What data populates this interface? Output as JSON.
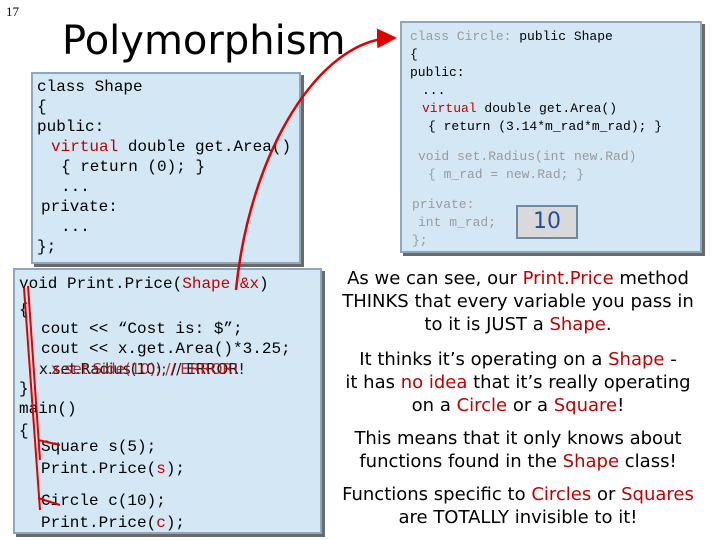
{
  "slide_number": "17",
  "title": "Polymorphism",
  "shape_class": {
    "l1": "class Shape",
    "l2": "{",
    "l3": "public:",
    "l4_kw": "virtual",
    "l4_rest": " double get.Area()",
    "l5": "{ return (0); }",
    "l6": "...",
    "l7": "private:",
    "l8": "...",
    "l9": "};"
  },
  "circle_class": {
    "l1a": "class Circle: ",
    "l1b": "public Shape",
    "l2": "{",
    "l3": "public:",
    "l4": "...",
    "l5_kw": "virtual",
    "l5_rest": " double get.Area()",
    "l6": "{ return (3.14*m_rad*m_rad); }",
    "l7": "void set.Radius(int new.Rad)",
    "l8": "{ m_rad = new.Rad; }",
    "l9": "private:",
    "l10": "int m_rad;",
    "l11": "};",
    "value_box": "10"
  },
  "main_code": {
    "l1a": "void Print.Price(",
    "l1b": "Shape &x",
    "l1c": ")",
    "l2": "{",
    "l3": "cout << “Cost is: $”;",
    "l4": "cout << x.get.Area()*3.25;",
    "l5_a": "x.set.Radius(10); // ERROR!",
    "l5_b": "x.set.Side(10); // ERROR!",
    "l6": "}",
    "l7": "main()",
    "l8": "{",
    "l9": "Square s(5);",
    "l10a": "Print.Price(",
    "l10b": "s",
    "l10c": ");",
    "l11": "Circle c(10);",
    "l12a": "Print.Price(",
    "l12b": "c",
    "l12c": ");"
  },
  "explanation": {
    "p1_a": "As we can see, our ",
    "p1_b": "Print.Price",
    "p1_c": " method",
    "p1_d": "THINKS that every variable you pass in",
    "p1_e": "to it is JUST a ",
    "p1_f": "Shape",
    "p1_g": ".",
    "p2_a": "It thinks it’s operating on a ",
    "p2_b": "Shape",
    "p2_c": " -",
    "p2_d": "it has ",
    "p2_e": "no idea",
    "p2_f": " that it’s really operating",
    "p2_g": "on a ",
    "p2_h": "Circle",
    "p2_i": " or a ",
    "p2_j": "Square",
    "p2_k": "!",
    "p3_a": "This means that it only knows about",
    "p3_b": "functions found in the ",
    "p3_c": "Shape",
    "p3_d": " class!",
    "p4_a": "Functions specific to ",
    "p4_b": "Circles",
    "p4_c": " or ",
    "p4_d": "Squares",
    "p4_e": "are TOTALLY invisible to it!"
  },
  "colors": {
    "keyword": "#c00000",
    "box_fill": "#d3e8f4",
    "arrow": "#e00000"
  }
}
